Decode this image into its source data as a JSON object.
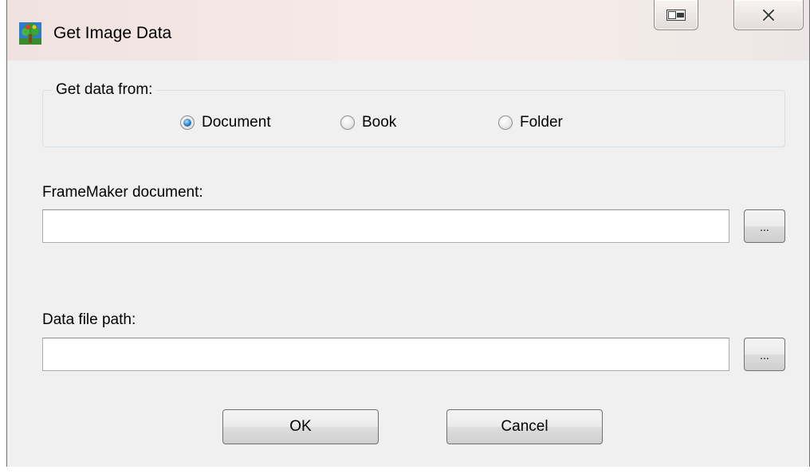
{
  "window": {
    "title": "Get Image Data",
    "icons": {
      "app": "tree-app-icon",
      "snap": "window-snap-icon",
      "close": "close-icon"
    }
  },
  "source_group": {
    "label": "Get data from:",
    "options": [
      {
        "label": "Document",
        "checked": true
      },
      {
        "label": "Book",
        "checked": false
      },
      {
        "label": "Folder",
        "checked": false
      }
    ]
  },
  "document_field": {
    "label": "FrameMaker document:",
    "value": "",
    "browse_label": "..."
  },
  "data_path_field": {
    "label": "Data file path:",
    "value": "",
    "browse_label": "..."
  },
  "buttons": {
    "ok_label": "OK",
    "cancel_label": "Cancel"
  },
  "colors": {
    "titlebar": "#f3e6e2",
    "client": "#f0f0f0",
    "radio_selected": "#2a7ec8"
  }
}
